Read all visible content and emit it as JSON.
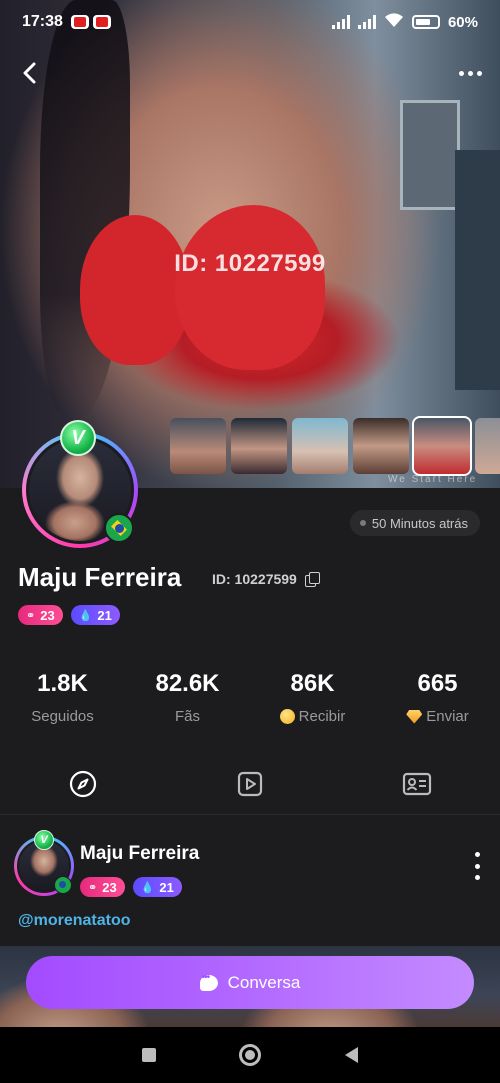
{
  "status_bar": {
    "time": "17:38",
    "battery": "60%"
  },
  "hero": {
    "watermark_id": "ID: 10227599",
    "thumbnail_caption": "We Start Here"
  },
  "profile": {
    "name": "Maju Ferreira",
    "id_label": "ID: 10227599",
    "last_seen": "50 Minutos atrás",
    "badge_level": "23",
    "badge_drops": "21",
    "verified_badge": "V"
  },
  "stats": [
    {
      "value": "1.8K",
      "label": "Seguidos",
      "icon": ""
    },
    {
      "value": "82.6K",
      "label": "Fãs",
      "icon": ""
    },
    {
      "value": "86K",
      "label": "Recibir",
      "icon": "coin-icon"
    },
    {
      "value": "665",
      "label": "Enviar",
      "icon": "gem-icon"
    }
  ],
  "tabs": [
    "moments-compass-icon",
    "video-play-icon",
    "profile-card-icon"
  ],
  "post": {
    "author": "Maju Ferreira",
    "badge_level": "23",
    "badge_drops": "21",
    "handle": "@morenatatoo"
  },
  "chat_button": {
    "label": "Conversa"
  },
  "colors": {
    "accent": "#a34bff",
    "handle": "#4fb3e8",
    "badge_pink": "#e52a7e",
    "badge_violet": "#5b4cff"
  }
}
